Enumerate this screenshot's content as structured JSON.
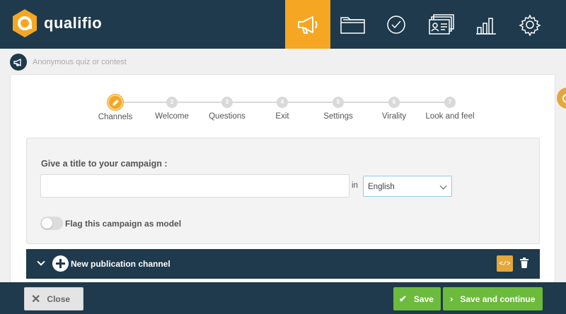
{
  "brand": {
    "name": "qualifio",
    "color": "#f5a623"
  },
  "nav": {
    "items": [
      {
        "icon": "megaphone-icon",
        "active": true
      },
      {
        "icon": "folder-icon",
        "active": false
      },
      {
        "icon": "check-circle-icon",
        "active": false
      },
      {
        "icon": "contacts-card-icon",
        "active": false
      },
      {
        "icon": "bar-chart-icon",
        "active": false
      },
      {
        "icon": "gear-icon",
        "active": false
      }
    ]
  },
  "breadcrumb": {
    "icon": "megaphone-icon",
    "text": "Anonymous quiz or contest"
  },
  "stepper": {
    "steps": [
      {
        "number": "",
        "label": "Channels",
        "active": true
      },
      {
        "number": "2",
        "label": "Welcome",
        "active": false
      },
      {
        "number": "3",
        "label": "Questions",
        "active": false
      },
      {
        "number": "4",
        "label": "Exit",
        "active": false
      },
      {
        "number": "5",
        "label": "Settings",
        "active": false
      },
      {
        "number": "6",
        "label": "Virality",
        "active": false
      },
      {
        "number": "7",
        "label": "Look and feel",
        "active": false
      }
    ]
  },
  "form": {
    "title_label": "Give a title to your campaign :",
    "title_value": "",
    "in_label": "in",
    "language": "English",
    "model_toggle_label": "Flag this campaign as model",
    "model_toggle_on": false
  },
  "channel": {
    "label": "New publication channel",
    "code_icon": "</>"
  },
  "footer": {
    "close_label": "Close",
    "save_label": "Save",
    "save_continue_label": "Save and continue"
  },
  "colors": {
    "navy": "#1e3a4c",
    "orange": "#f5a623",
    "green": "#6cbb3c"
  }
}
